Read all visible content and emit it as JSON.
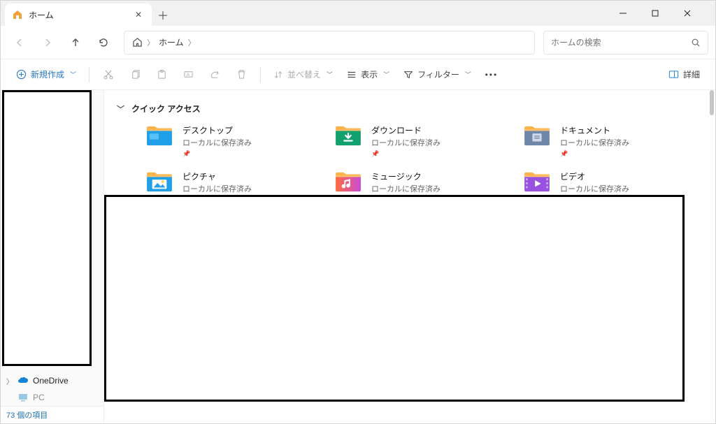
{
  "tab": {
    "title": "ホーム"
  },
  "breadcrumb": {
    "current": "ホーム"
  },
  "search": {
    "placeholder": "ホームの検索"
  },
  "toolbar": {
    "new_label": "新規作成",
    "sort_label": "並べ替え",
    "view_label": "表示",
    "filter_label": "フィルター",
    "details_label": "詳細"
  },
  "section": {
    "quick_access": "クイック アクセス"
  },
  "quick_access_items": [
    {
      "name": "デスクトップ",
      "sub": "ローカルに保存済み",
      "color": "blue"
    },
    {
      "name": "ダウンロード",
      "sub": "ローカルに保存済み",
      "color": "green"
    },
    {
      "name": "ドキュメント",
      "sub": "ローカルに保存済み",
      "color": "slate"
    },
    {
      "name": "ピクチャ",
      "sub": "ローカルに保存済み",
      "color": "photo"
    },
    {
      "name": "ミュージック",
      "sub": "ローカルに保存済み",
      "color": "music"
    },
    {
      "name": "ビデオ",
      "sub": "ローカルに保存済み",
      "color": "video"
    }
  ],
  "sidebar": {
    "onedrive": "OneDrive",
    "pc": "PC"
  },
  "status": {
    "text": "73 個の項目"
  }
}
